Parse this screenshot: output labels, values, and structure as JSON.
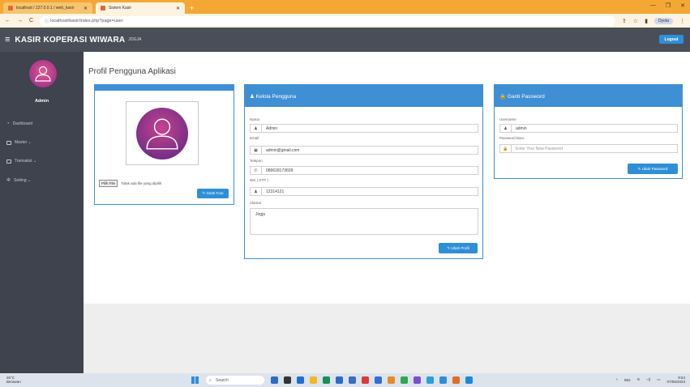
{
  "browser": {
    "tabs": [
      {
        "label": "localhost / 127.0.0.1 / web_kasir"
      },
      {
        "label": "Sistem Kasir"
      }
    ],
    "url": "localhost/kasir/index.php?page=user",
    "profile_label": "Dyota"
  },
  "app": {
    "brand": "KASIR KOPERASI WIWARA",
    "brand_sub": "JOGJA",
    "logout_label": "Logout"
  },
  "sidebar": {
    "user_name": "Admin",
    "items": [
      {
        "label": "Dashboard"
      },
      {
        "label": "Master ⌄"
      },
      {
        "label": "Transaksi ⌄"
      },
      {
        "label": "Setting ⌄"
      }
    ]
  },
  "page": {
    "title": "Profil Pengguna Aplikasi"
  },
  "photo_card": {
    "file_button": "Pilih File",
    "file_status": "Tidak ada file yang dipilih",
    "change_photo_button": "✎ Ganti Foto"
  },
  "user_card": {
    "title": "♟ Kelola Pengguna",
    "fields": {
      "nama_label": "Nama",
      "nama_value": "Admin",
      "email_label": "Email",
      "email_value": "admin@gmail.com",
      "telepon_label": "Telepon",
      "telepon_value": "089618173609",
      "nik_label": "NIK ( KTP )",
      "nik_value": "12314121",
      "alamat_label": "Alamat",
      "alamat_value": "Jogja"
    },
    "submit_button": "✎ Ubah Profil"
  },
  "password_card": {
    "title": "🔒 Ganti Password",
    "username_label": "Username",
    "username_value": "admin",
    "password_label": "Password Baru",
    "password_placeholder": "Enter Your New Password",
    "submit_button": "✎ Ubah Password"
  },
  "taskbar": {
    "weather_temp": "26°C",
    "weather_desc": "Berawan",
    "search_label": "Search",
    "tray_lang": "IND",
    "time": "9:54",
    "date": "07/06/2023"
  },
  "colors": {
    "accent": "#3e8fd4",
    "topbar": "#4a4e59",
    "sidebar": "#3e434d",
    "chrome": "#f4a833"
  }
}
